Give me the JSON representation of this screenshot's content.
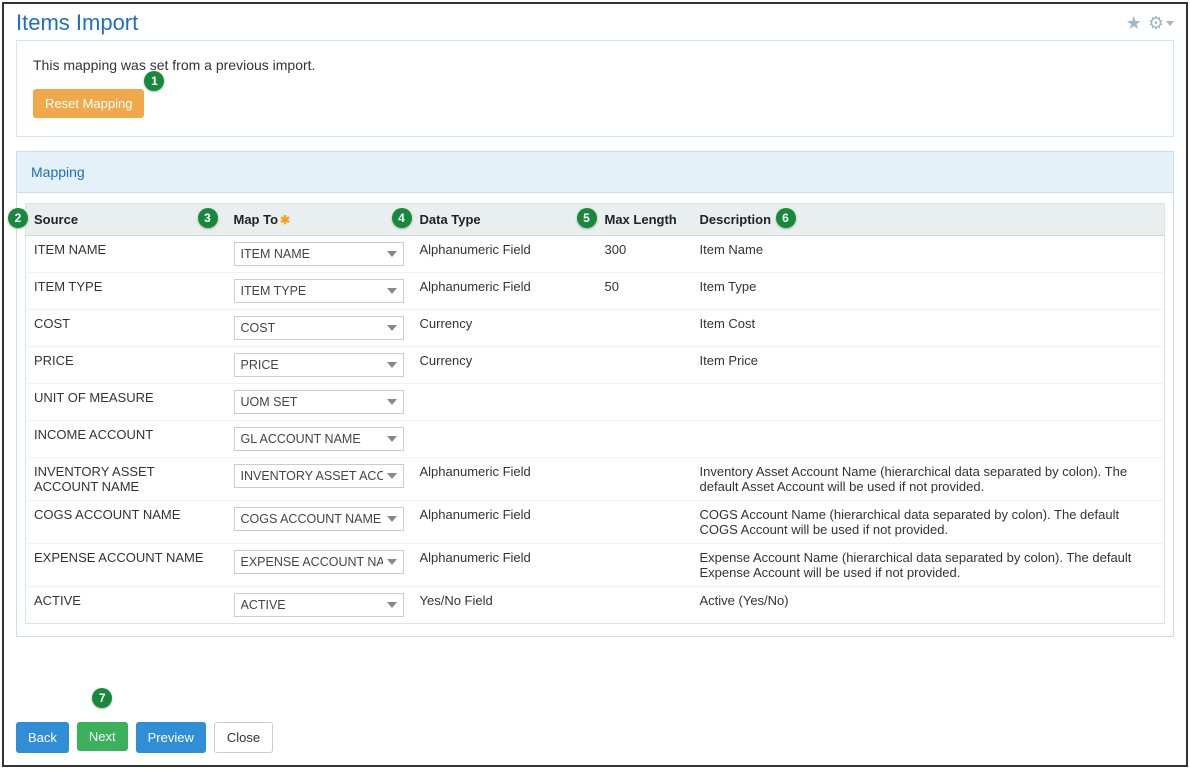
{
  "header": {
    "title": "Items Import",
    "star_icon": "★",
    "gear_icon": "⚙"
  },
  "info_panel": {
    "message": "This mapping was set from a previous import.",
    "reset_label": "Reset Mapping"
  },
  "mapping_section": {
    "title": "Mapping"
  },
  "table": {
    "headers": {
      "source": "Source",
      "map_to": "Map To",
      "data_type": "Data Type",
      "max_length": "Max Length",
      "description": "Description"
    },
    "rows": [
      {
        "source": "ITEM NAME",
        "map_to": "ITEM NAME",
        "data_type": "Alphanumeric Field",
        "max_length": "300",
        "description": "Item Name"
      },
      {
        "source": "ITEM TYPE",
        "map_to": "ITEM TYPE",
        "data_type": "Alphanumeric Field",
        "max_length": "50",
        "description": "Item Type"
      },
      {
        "source": "COST",
        "map_to": "COST",
        "data_type": "Currency",
        "max_length": "",
        "description": "Item Cost"
      },
      {
        "source": "PRICE",
        "map_to": "PRICE",
        "data_type": "Currency",
        "max_length": "",
        "description": "Item Price"
      },
      {
        "source": "UNIT OF MEASURE",
        "map_to": "UOM SET",
        "data_type": "",
        "max_length": "",
        "description": ""
      },
      {
        "source": "INCOME ACCOUNT",
        "map_to": "GL ACCOUNT NAME",
        "data_type": "",
        "max_length": "",
        "description": ""
      },
      {
        "source": "INVENTORY ASSET ACCOUNT NAME",
        "map_to": "INVENTORY ASSET ACCO",
        "data_type": "Alphanumeric Field",
        "max_length": "",
        "description": "Inventory Asset Account Name (hierarchical data separated by colon). The default Asset Account will be used if not provided."
      },
      {
        "source": "COGS ACCOUNT NAME",
        "map_to": "COGS ACCOUNT NAME",
        "data_type": "Alphanumeric Field",
        "max_length": "",
        "description": "COGS Account Name (hierarchical data separated by colon). The default COGS Account will be used if not provided."
      },
      {
        "source": "EXPENSE ACCOUNT NAME",
        "map_to": "EXPENSE ACCOUNT NAM",
        "data_type": "Alphanumeric Field",
        "max_length": "",
        "description": "Expense Account Name (hierarchical data separated by colon). The default Expense Account will be used if not provided."
      },
      {
        "source": "ACTIVE",
        "map_to": "ACTIVE",
        "data_type": "Yes/No Field",
        "max_length": "",
        "description": "Active (Yes/No)"
      }
    ]
  },
  "footer": {
    "back": "Back",
    "next": "Next",
    "preview": "Preview",
    "close": "Close"
  },
  "annotations": {
    "b1": "1",
    "b2": "2",
    "b3": "3",
    "b4": "4",
    "b5": "5",
    "b6": "6",
    "b7": "7"
  }
}
